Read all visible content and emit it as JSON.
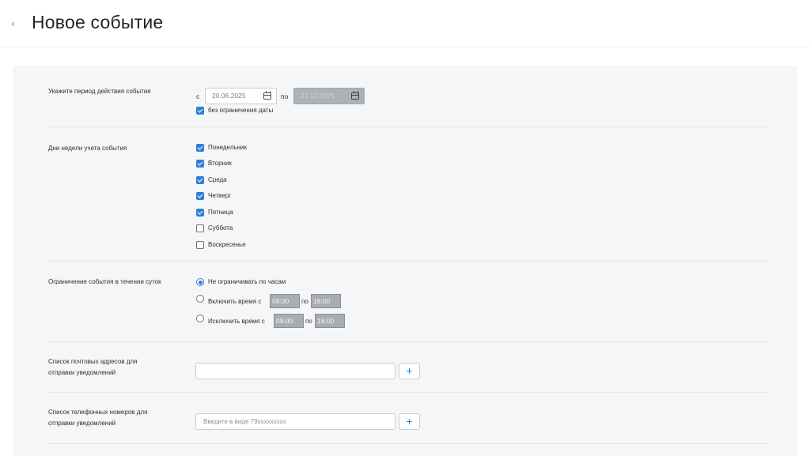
{
  "header": {
    "title": "Новое событие",
    "back_icon": "‹"
  },
  "period": {
    "label": "Укажите период действия события",
    "from_label": "с",
    "from_value": "20.06.2025",
    "to_label": "по",
    "to_value": "31.12.2025",
    "no_limit_label": "без ограничения даты",
    "no_limit_checked": true
  },
  "weekdays": {
    "label": "Дни недели учета события",
    "days": [
      {
        "label": "Понедельник",
        "checked": true
      },
      {
        "label": "Вторник",
        "checked": true
      },
      {
        "label": "Среда",
        "checked": true
      },
      {
        "label": "Четверг",
        "checked": true
      },
      {
        "label": "Пятница",
        "checked": true
      },
      {
        "label": "Суббота",
        "checked": false
      },
      {
        "label": "Воскресенье",
        "checked": false
      }
    ]
  },
  "daily_limit": {
    "label": "Ограничение события в течении суток",
    "options": [
      {
        "label": "Не ограничивать по часам",
        "selected": true
      },
      {
        "label": "Включить время с",
        "selected": false,
        "from": "09:00",
        "to_label": "по",
        "to": "18:00"
      },
      {
        "label": "Исключить время с",
        "selected": false,
        "from": "09:00",
        "to_label": "по",
        "to": "18:00"
      }
    ]
  },
  "emails": {
    "label_line1": "Список почтовых адресов для",
    "label_line2": "отправки уведомлений",
    "value": "",
    "placeholder": "",
    "add_label": "+"
  },
  "phones": {
    "label_line1": "Список телефонных номеров для",
    "label_line2": "отправки уведомлений",
    "value": "",
    "placeholder": "Введите в виде 79xxxxxxxxx",
    "add_label": "+"
  },
  "colors": {
    "accent": "#2e7fd6",
    "panel": "#f5f6f7",
    "disabled": "#a9acb0"
  }
}
